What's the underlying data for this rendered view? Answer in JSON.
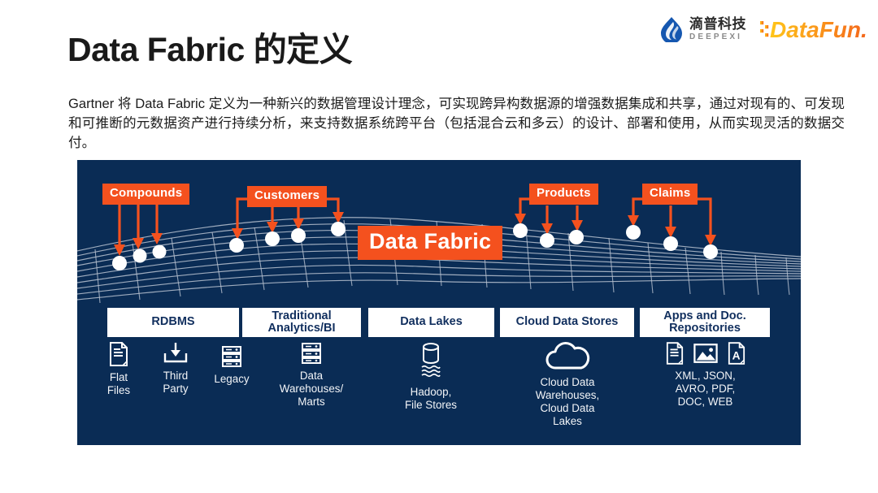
{
  "slide": {
    "title_en": "Data Fabric",
    "title_cn": " 的定义",
    "body": "Gartner 将 Data Fabric 定义为一种新兴的数据管理设计理念，可实现跨异构数据源的增强数据集成和共享，通过对现有的、可发现和可推断的元数据资产进行持续分析，来支持数据系统跨平台（包括混合云和多云）的设计、部署和使用，从而实现灵活的数据交付。"
  },
  "logos": {
    "deepexi": {
      "icon": "water-droplet-icon",
      "cn": "滴普科技",
      "en": "DEEPEXI",
      "color": "#1557b0"
    },
    "datafun": {
      "text": "DataFun.",
      "color_start": "#ffc61a",
      "color_end": "#f26d21"
    }
  },
  "diagram": {
    "background": "#0a2c55",
    "accent": "#f4511e",
    "mesh_color": "#c3cbd6",
    "center_label": "Data Fabric",
    "source_labels": [
      {
        "label": "Compounds",
        "arrows": 3
      },
      {
        "label": "Customers",
        "arrows": 4
      },
      {
        "label": "Products",
        "arrows": 3
      },
      {
        "label": "Claims",
        "arrows": 3
      }
    ],
    "categories": [
      {
        "label": "RDBMS"
      },
      {
        "label": "Traditional\nAnalytics/BI"
      },
      {
        "label": "Data Lakes"
      },
      {
        "label": "Cloud Data Stores"
      },
      {
        "label": "Apps and Doc.\nRepositories"
      }
    ],
    "items": [
      {
        "icon": "document-icon",
        "label": "Flat\nFiles"
      },
      {
        "icon": "download-tray-icon",
        "label": "Third\nParty"
      },
      {
        "icon": "server-rack-icon",
        "label": "Legacy"
      },
      {
        "icon": "server-rack-icon",
        "label": "Data\nWarehouses/\nMarts"
      },
      {
        "icon": "database-waves-icon",
        "label": "Hadoop,\nFile Stores"
      },
      {
        "icon": "cloud-icon",
        "label": "Cloud Data\nWarehouses,\nCloud Data\nLakes"
      },
      {
        "icon": "document-image-text-icons",
        "label": "XML, JSON,\nAVRO, PDF,\nDOC, WEB"
      }
    ]
  }
}
